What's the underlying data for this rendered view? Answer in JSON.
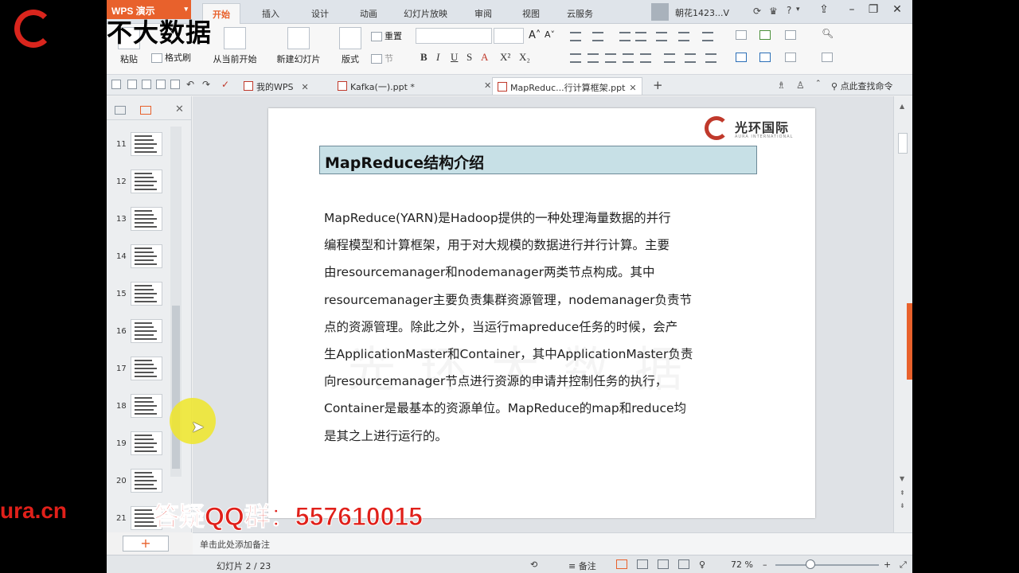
{
  "app": {
    "name": "WPS 演示",
    "menu_tabs": [
      "开始",
      "插入",
      "设计",
      "动画",
      "幻灯片放映",
      "审阅",
      "视图",
      "云服务"
    ],
    "user_name": "朝花1423...V",
    "help_label": "?"
  },
  "ribbon": {
    "paste": "粘贴",
    "format_painter": "格式刷",
    "from_current": "从当前开始",
    "new_slide": "新建幻灯片",
    "layout": "版式",
    "reset": "重置",
    "section": "节"
  },
  "docbar": {
    "tabs": [
      {
        "label": "我的WPS"
      },
      {
        "label": "Kafka(一).ppt *"
      },
      {
        "label": "MapReduc...行计算框架.ppt"
      }
    ],
    "add_tab": "+",
    "search_command": "点此查找命令"
  },
  "thumbnails": {
    "numbers": [
      "11",
      "12",
      "13",
      "14",
      "15",
      "16",
      "17",
      "18",
      "19",
      "20",
      "21"
    ]
  },
  "slide": {
    "logo_text": "光环国际",
    "logo_sub": "AURA INTERNATIONAL",
    "title": "MapReduce结构介绍",
    "body_lines": [
      "  MapReduce(YARN)是Hadoop提供的一种处理海量数据的并行",
      "编程模型和计算框架，用于对大规模的数据进行并行计算。主要",
      "由resourcemanager和nodemanager两类节点构成。其中",
      "resourcemanager主要负责集群资源管理，nodemanager负责节",
      "点的资源管理。除此之外，当运行mapreduce任务的时候，会产",
      "生ApplicationMaster和Container，其中ApplicationMaster负责",
      "向resourcemanager节点进行资源的申请并控制任务的执行，",
      "Container是最基本的资源单位。MapReduce的map和reduce均",
      "是其之上进行运行的。"
    ]
  },
  "notes": {
    "placeholder": "单击此处添加备注"
  },
  "status": {
    "slide_counter": "幻灯片 2 / 23",
    "notes_label": "备注",
    "zoom": "72 %"
  },
  "overlay": {
    "brand": "不大数据",
    "url_fragment": "ura.cn",
    "qq_group": "答疑QQ群：557610015"
  },
  "colors": {
    "accent": "#e8612c",
    "title_fill": "#c7e0e6",
    "overlay_red": "#e0201a",
    "cursor_highlight": "#f0e628"
  }
}
